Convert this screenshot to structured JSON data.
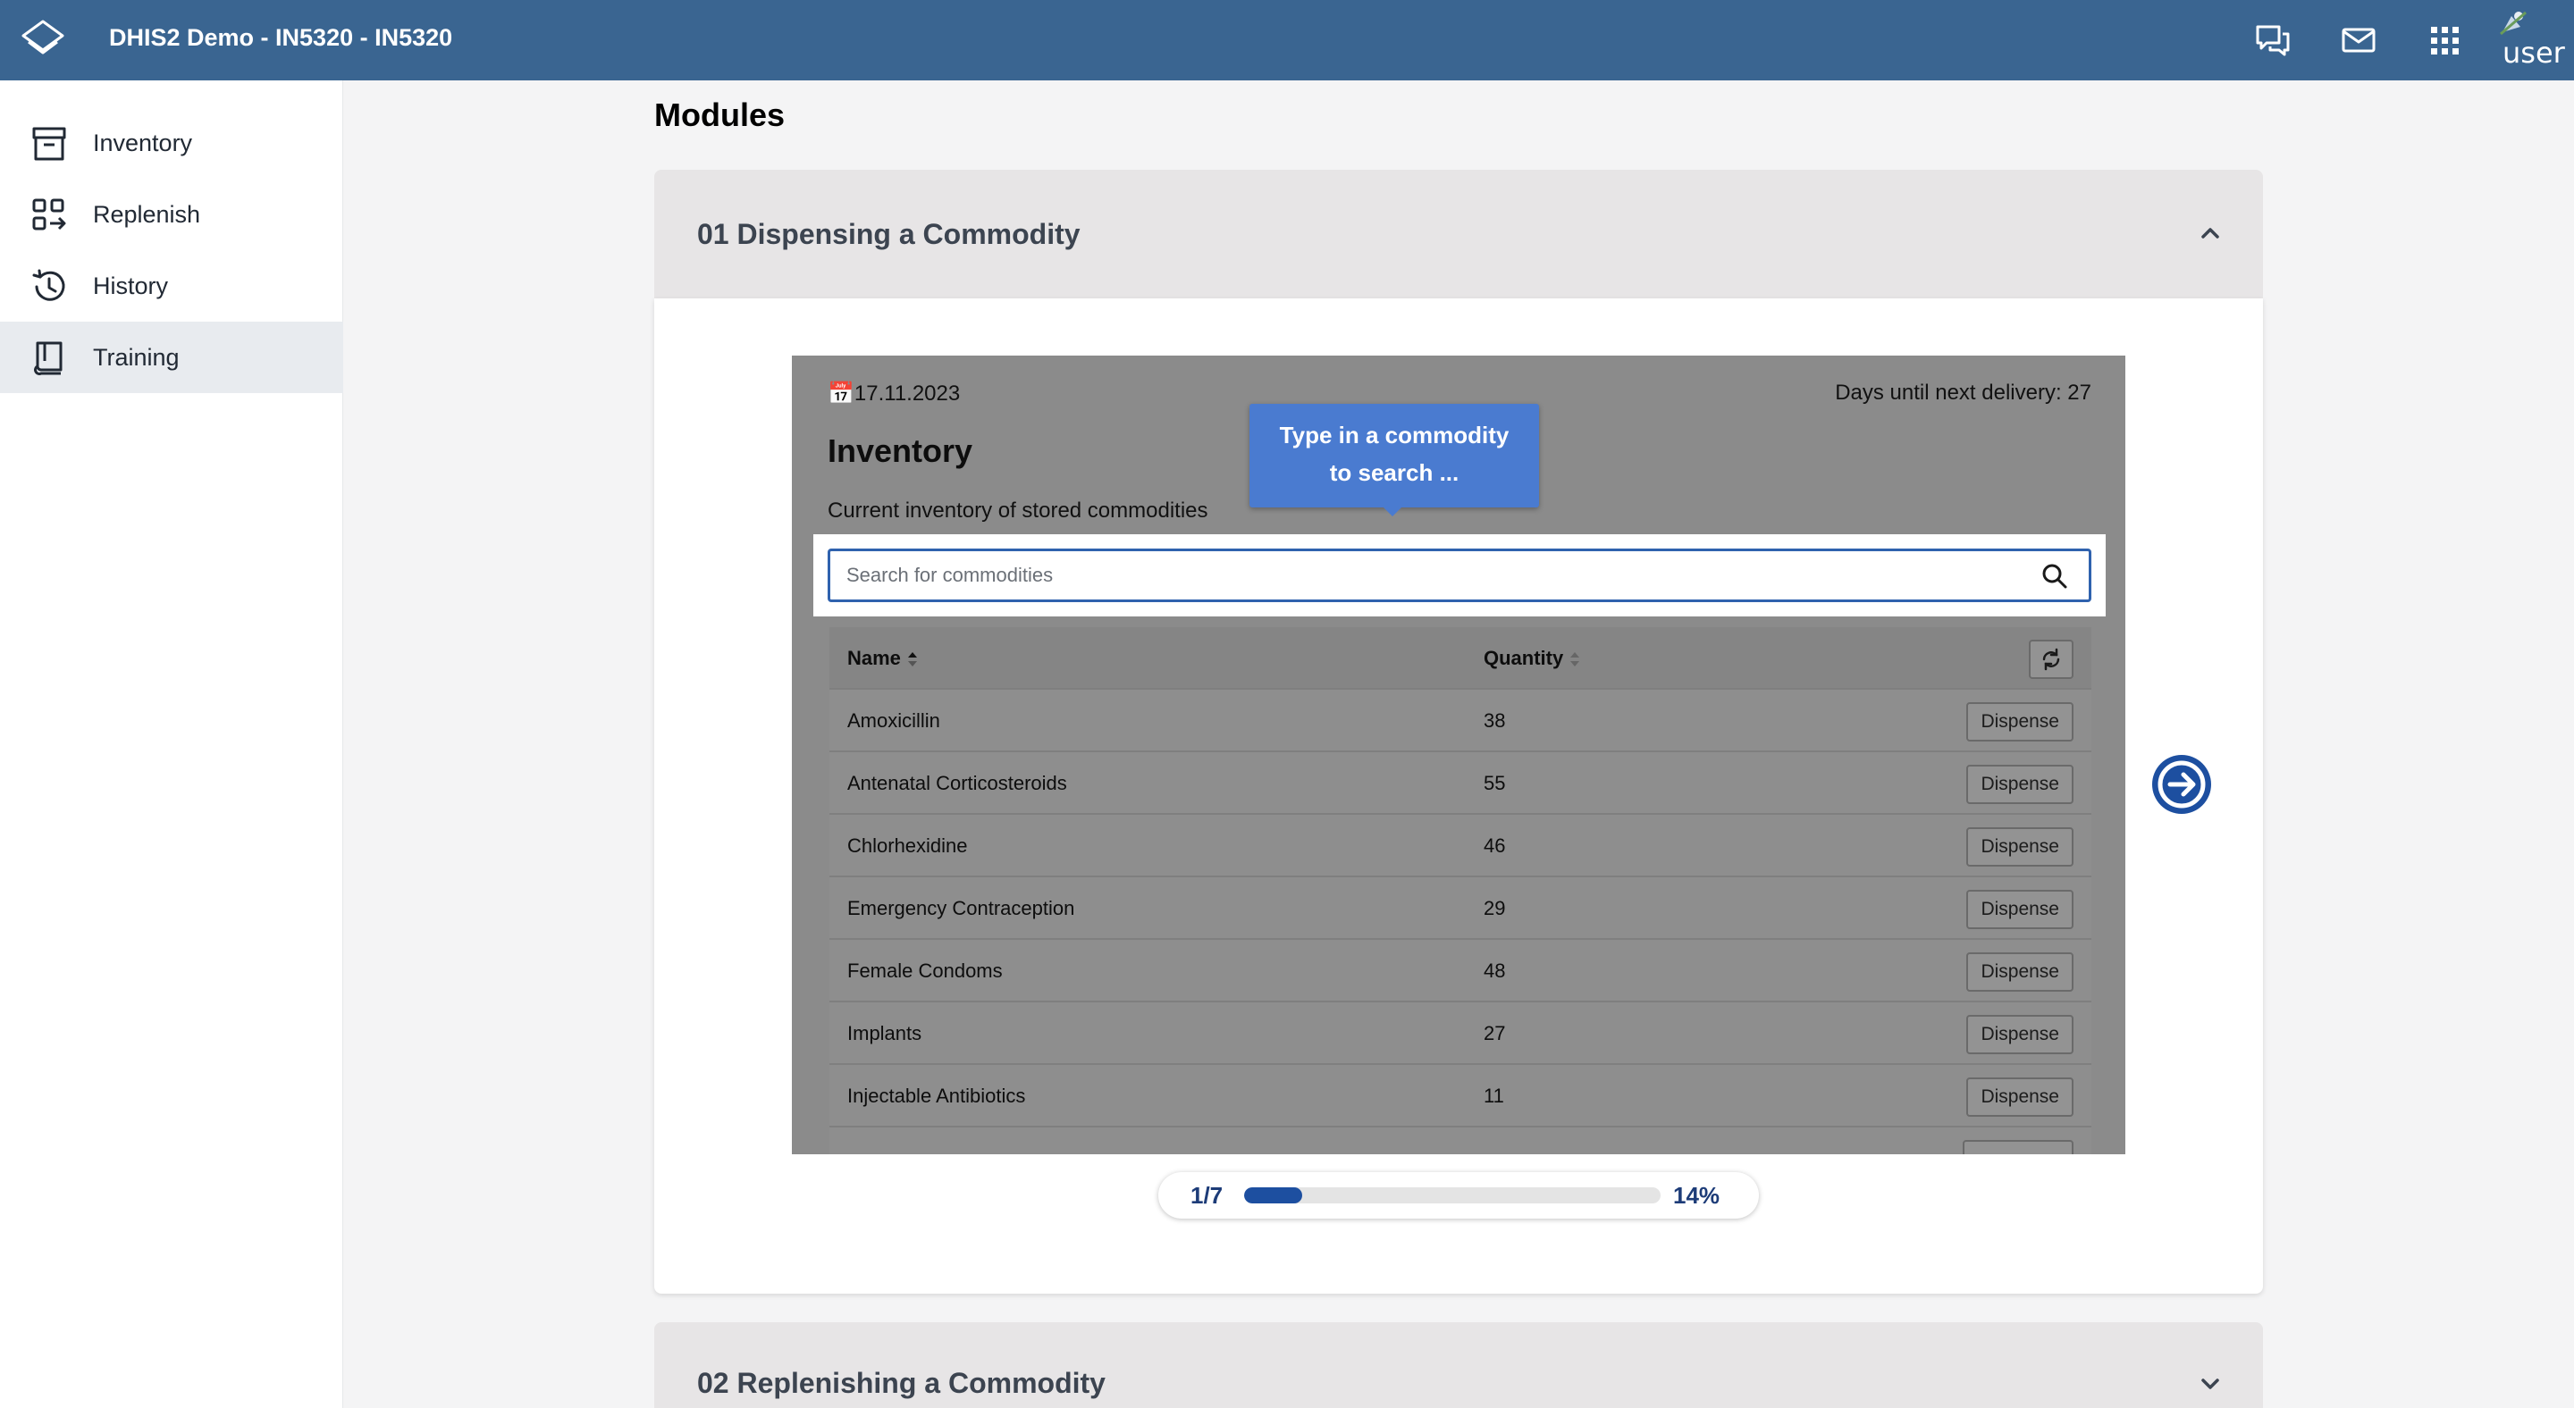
{
  "app": {
    "title": "DHIS2 Demo - IN5320 - IN5320",
    "user_label": "user"
  },
  "header_icons": [
    "chat-icon",
    "mail-icon",
    "apps-grid-icon"
  ],
  "sidebar": {
    "items": [
      {
        "label": "Inventory",
        "icon": "archive-box-icon",
        "active": false
      },
      {
        "label": "Replenish",
        "icon": "replenish-icon",
        "active": false
      },
      {
        "label": "History",
        "icon": "history-icon",
        "active": false
      },
      {
        "label": "Training",
        "icon": "book-icon",
        "active": true
      }
    ]
  },
  "main": {
    "heading": "Modules",
    "modules": [
      {
        "title": "01 Dispensing a Commodity",
        "expanded": true
      },
      {
        "title": "02 Replenishing a Commodity",
        "expanded": false
      }
    ]
  },
  "slide": {
    "date": "17.11.2023",
    "days_until": "Days until next delivery: 27",
    "title": "Inventory",
    "subtitle": "Current inventory of stored commodities",
    "tooltip_line1": "Type in a commodity",
    "tooltip_line2": "to search ...",
    "search_placeholder": "Search for commodities",
    "table": {
      "col_name": "Name",
      "col_qty": "Quantity",
      "button_label": "Dispense",
      "rows": [
        {
          "name": "Amoxicillin",
          "qty": "38"
        },
        {
          "name": "Antenatal Corticosteroids",
          "qty": "55"
        },
        {
          "name": "Chlorhexidine",
          "qty": "46"
        },
        {
          "name": "Emergency Contraception",
          "qty": "29"
        },
        {
          "name": "Female Condoms",
          "qty": "48"
        },
        {
          "name": "Implants",
          "qty": "27"
        },
        {
          "name": "Injectable Antibiotics",
          "qty": "11"
        }
      ]
    }
  },
  "progress": {
    "step": "1/7",
    "percent_label": "14%",
    "fraction": 0.14
  },
  "colors": {
    "header": "#3a6591",
    "accent": "#1d4fa0",
    "tooltip": "#4a7bd0"
  }
}
